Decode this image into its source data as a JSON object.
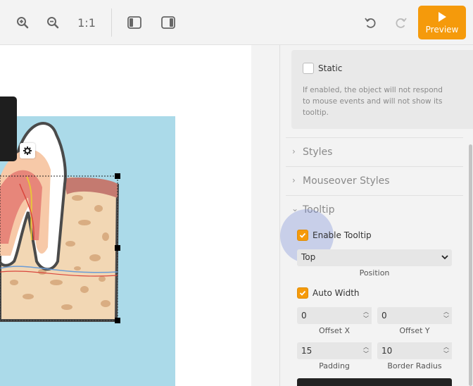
{
  "toolbar": {
    "zoom_reset_label": "1:1",
    "preview_label": "Preview",
    "icons": [
      "zoom-in-icon",
      "zoom-out-icon",
      "panel-left-icon",
      "panel-right-icon",
      "undo-icon",
      "redo-icon",
      "play-icon"
    ]
  },
  "accent_color": "#f59a0b",
  "panel": {
    "static": {
      "label": "Static",
      "checked": false,
      "help": "If enabled, the object will not respond to mouse events and will not show its tooltip."
    },
    "sections": [
      {
        "title": "Styles",
        "expanded": false
      },
      {
        "title": "Mouseover Styles",
        "expanded": false
      },
      {
        "title": "Tooltip",
        "expanded": true
      }
    ],
    "tooltip": {
      "enable_label": "Enable Tooltip",
      "enable_checked": true,
      "position_value": "Top",
      "position_caption": "Position",
      "auto_width_label": "Auto Width",
      "auto_width_checked": true,
      "offset_x": "0",
      "offset_x_caption": "Offset X",
      "offset_y": "0",
      "offset_y_caption": "Offset Y",
      "padding": "15",
      "padding_caption": "Padding",
      "border_radius": "10",
      "border_radius_caption": "Border Radius"
    }
  }
}
